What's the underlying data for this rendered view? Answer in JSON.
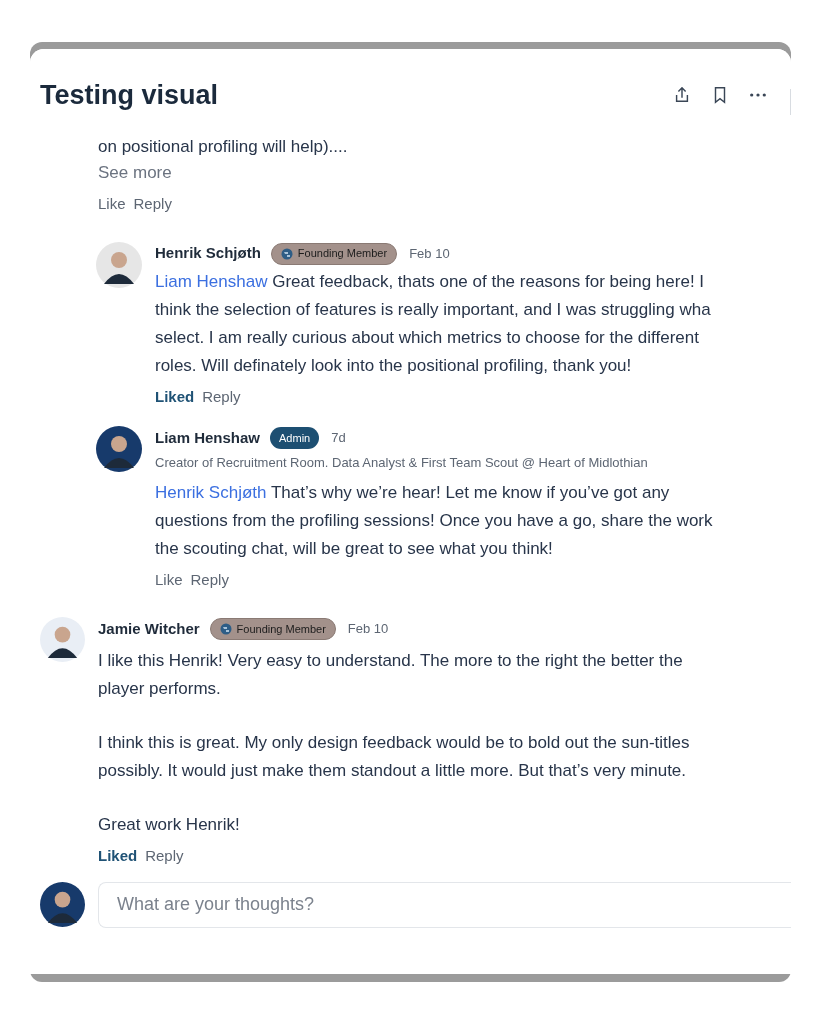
{
  "header": {
    "title": "Testing visual"
  },
  "thread": {
    "lines": [
      "on positional profiling will help)...."
    ],
    "see_more": "See more",
    "liked": false,
    "like_label": "Like",
    "reply_label": "Reply",
    "replies": [
      {
        "author": "Henrik Schjøth",
        "badge": {
          "kind": "founding",
          "label": "Founding Member"
        },
        "time": "Feb 10",
        "mention": "Liam Henshaw",
        "lines": [
          "Great feedback, thats one of the reasons for being here!  I",
          "think the selection of features is really important, and I was struggling wha",
          "select. I am really curious about which metrics to choose for the different",
          "roles. Will definately look into the positional profiling, thank you!"
        ],
        "liked": true,
        "like_label": "Liked",
        "reply_label": "Reply"
      },
      {
        "author": "Liam Henshaw",
        "badge": {
          "kind": "admin",
          "label": "Admin"
        },
        "time": "7d",
        "subtitle": "Creator of Recruitment Room. Data Analyst & First Team Scout @ Heart of Midlothian",
        "mention": "Henrik Schjøth",
        "lines": [
          "That’s why we’re hear! Let me know if you’ve got any",
          "questions from the profiling sessions! Once you have a go, share the work",
          "the scouting chat, will be great to see what you think!"
        ],
        "liked": false,
        "like_label": "Like",
        "reply_label": "Reply"
      }
    ]
  },
  "comments": [
    {
      "author": "Jamie Witcher",
      "badge": {
        "kind": "founding",
        "label": "Founding Member"
      },
      "time": "Feb 10",
      "paragraphs": [
        [
          "I like this Henrik! Very easy to understand. The more to the right the better the",
          "player performs."
        ],
        [
          "I think this is great. My only design feedback would be to bold out the sun-titles",
          "possibly. It would just make them standout a little more. But that’s very minute."
        ],
        [
          "Great work Henrik!"
        ]
      ],
      "liked": true,
      "like_label": "Liked",
      "reply_label": "Reply"
    }
  ],
  "composer": {
    "placeholder": "What are your thoughts?"
  }
}
